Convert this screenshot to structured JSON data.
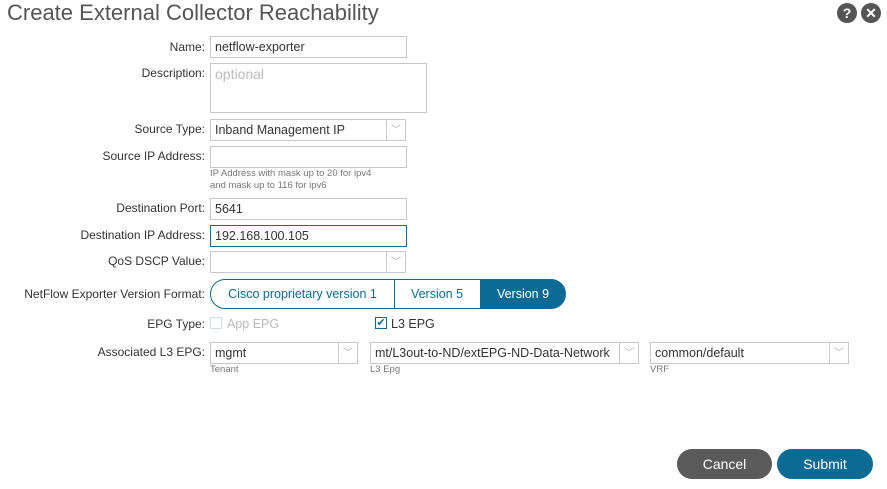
{
  "title": "Create External Collector Reachability",
  "fields": {
    "name": {
      "label": "Name:",
      "value": "netflow-exporter"
    },
    "description": {
      "label": "Description:",
      "placeholder": "optional"
    },
    "source_type": {
      "label": "Source Type:",
      "value": "Inband Management IP"
    },
    "source_ip": {
      "label": "Source IP Address:",
      "value": "",
      "hint1": "IP Address with mask up to 20 for ipv4",
      "hint2": "and mask up to 116 for ipv6"
    },
    "dest_port": {
      "label": "Destination Port:",
      "value": "5641"
    },
    "dest_ip": {
      "label": "Destination IP Address:",
      "value": "192.168.100.105"
    },
    "qos": {
      "label": "QoS DSCP Value:",
      "value": ""
    },
    "version": {
      "label": "NetFlow Exporter Version Format:",
      "options": [
        "Cisco proprietary version 1",
        "Version 5",
        "Version 9"
      ],
      "selected": "Version 9"
    },
    "epg_type": {
      "label": "EPG Type:",
      "app_epg": "App EPG",
      "l3_epg": "L3 EPG",
      "app_checked": false,
      "l3_checked": true
    },
    "assoc": {
      "label": "Associated L3 EPG:",
      "tenant": "mgmt",
      "tenant_label": "Tenant",
      "l3epg": "mt/L3out-to-ND/extEPG-ND-Data-Network",
      "l3epg_label": "L3 Epg",
      "vrf": "common/default",
      "vrf_label": "VRF"
    }
  },
  "buttons": {
    "cancel": "Cancel",
    "submit": "Submit"
  },
  "icons": {
    "help": "?",
    "close": "✕"
  }
}
